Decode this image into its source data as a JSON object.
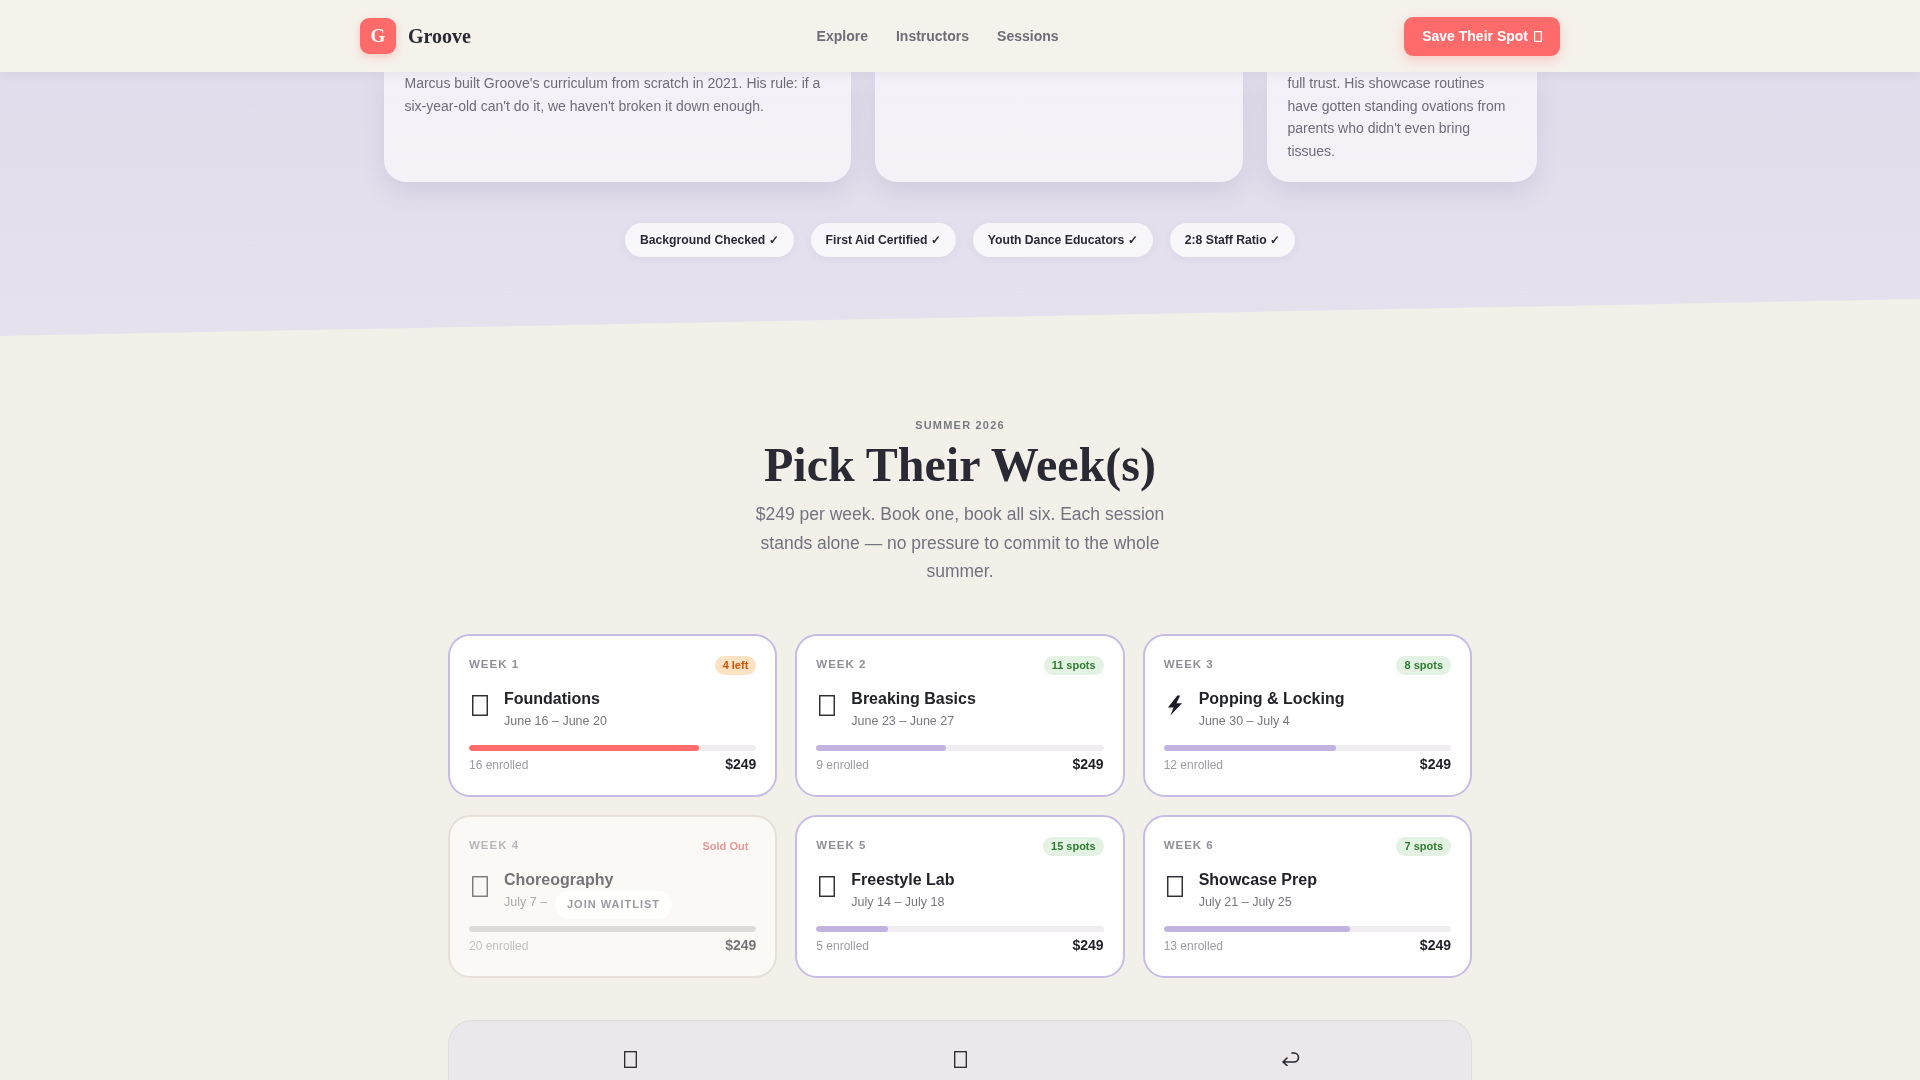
{
  "nav": {
    "logo_letter": "G",
    "brand": "Groove",
    "links": [
      "Explore",
      "Instructors",
      "Sessions"
    ],
    "cta": "Save Their Spot"
  },
  "instructor_cards": [
    {
      "bio": "Marcus built Groove's curriculum from scratch in 2021. His rule: if a six-year-old can't do it, we haven't broken it down enough."
    },
    {
      "bio": "full trust. His showcase routines have gotten standing ovations from parents who didn't even bring tissues."
    }
  ],
  "credentials": [
    "Background Checked ✓",
    "First Aid Certified ✓",
    "Youth Dance Educators ✓",
    "2:8 Staff Ratio ✓"
  ],
  "sessions": {
    "eyebrow": "SUMMER 2026",
    "title": "Pick Their Week(s)",
    "subtitle": "$249 per week. Book one, book all six. Each session stands alone — no pressure to commit to the whole summer.",
    "weeks": [
      {
        "label": "WEEK 1",
        "almost_full": true,
        "sold_out": false,
        "badge": "4 left",
        "icon": {
          "kind": "box"
        },
        "title": "Foundations",
        "dates": "June 16 – June 20",
        "level": 0.8,
        "enrolled": "16 enrolled",
        "price": "$249"
      },
      {
        "label": "WEEK 2",
        "almost_full": false,
        "sold_out": false,
        "badge": "11 spots",
        "icon": {
          "kind": "box"
        },
        "title": "Breaking Basics",
        "dates": "June 23 – June 27",
        "level": 0.45,
        "enrolled": "9 enrolled",
        "price": "$249"
      },
      {
        "label": "WEEK 3",
        "almost_full": false,
        "sold_out": false,
        "badge": "8 spots",
        "icon": {
          "kind": "bolt"
        },
        "title": "Popping & Locking",
        "dates": "June 30 – July 4",
        "level": 0.6,
        "enrolled": "12 enrolled",
        "price": "$249"
      },
      {
        "label": "WEEK 4",
        "almost_full": false,
        "sold_out": true,
        "badge": "Sold Out",
        "icon": {
          "kind": "box"
        },
        "title": "Choreography",
        "dates": "July 7 –",
        "level": 1,
        "enrolled": "20 enrolled",
        "price": "$249",
        "waitlist": "JOIN WAITLIST"
      },
      {
        "label": "WEEK 5",
        "almost_full": false,
        "sold_out": false,
        "badge": "15 spots",
        "icon": {
          "kind": "box"
        },
        "title": "Freestyle Lab",
        "dates": "July 14 – July 18",
        "level": 0.25,
        "enrolled": "5 enrolled",
        "price": "$249"
      },
      {
        "label": "WEEK 6",
        "almost_full": false,
        "sold_out": false,
        "badge": "7 spots",
        "icon": {
          "kind": "box"
        },
        "title": "Showcase Prep",
        "dates": "July 21 – July 25",
        "level": 0.65,
        "enrolled": "13 enrolled",
        "price": "$249"
      }
    ]
  },
  "features": [
    {
      "kind": "box"
    },
    {
      "kind": "box"
    },
    {
      "kind": "arrow"
    }
  ]
}
